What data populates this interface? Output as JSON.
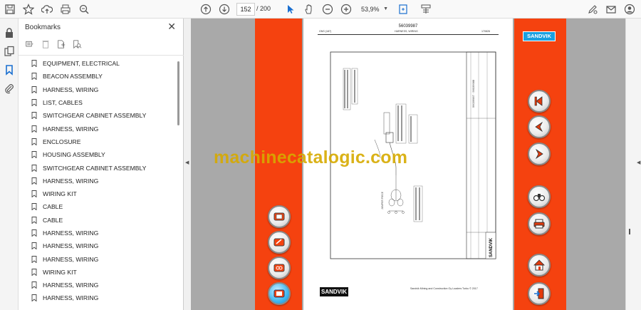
{
  "toolbar": {
    "page_current": "152",
    "page_total": "/ 200",
    "zoom": "53,9%"
  },
  "bookmarks": {
    "title": "Bookmarks",
    "items": [
      "EQUIPMENT, ELECTRICAL",
      "BEACON ASSEMBLY",
      "HARNESS, WIRING",
      "LIST, CABLES",
      "SWITCHGEAR CABINET ASSEMBLY",
      "HARNESS, WIRING",
      "ENCLOSURE",
      "HOUSING ASSEMBLY",
      "SWITCHGEAR CABINET ASSEMBLY",
      "HARNESS, WIRING",
      "WIRING KIT",
      "CABLE",
      "CABLE",
      "HARNESS, WIRING",
      "HARNESS, WIRING",
      "HARNESS, WIRING",
      "WIRING KIT",
      "HARNESS, WIRING",
      "HARNESS, WIRING"
    ]
  },
  "document": {
    "code": "56039987",
    "header_left": "GNS (187)",
    "header_center": "HARNESS, WIRING",
    "header_right": "170826",
    "footer": "Sandvik Mining and Construction Oy Loaders Turku © 2017",
    "logo_text": "SANDVIK",
    "brand_badge": "SANDVIK"
  },
  "watermark": "machinecatalogic.com",
  "colors": {
    "accent_orange": "#f5420f",
    "viewer_gray": "#a9a9a9",
    "sandvik_blue": "#1aa0e0",
    "watermark": "#d7aa00"
  },
  "icons": {
    "nav_left": [
      "document-icon",
      "document-edit-icon",
      "document-link-icon",
      "document-active-icon"
    ],
    "nav_right": [
      "first-page-icon",
      "previous-page-icon",
      "next-page-icon",
      "binoculars-icon",
      "print-icon",
      "home-icon",
      "exit-icon"
    ]
  }
}
